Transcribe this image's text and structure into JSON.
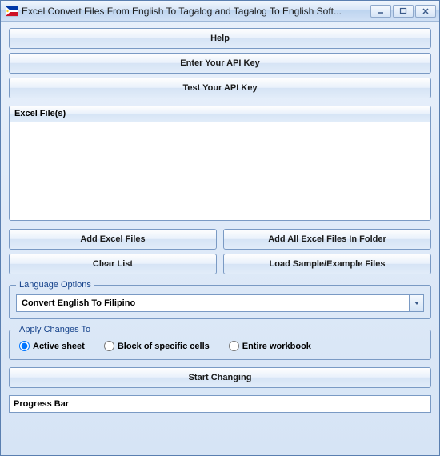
{
  "window": {
    "title": "Excel Convert Files From English To Tagalog and Tagalog To English Soft..."
  },
  "buttons": {
    "help": "Help",
    "enter_api": "Enter Your API Key",
    "test_api": "Test Your API Key",
    "add_files": "Add Excel Files",
    "add_folder": "Add All Excel Files In Folder",
    "clear_list": "Clear List",
    "load_sample": "Load Sample/Example Files",
    "start": "Start Changing"
  },
  "filebox": {
    "header": "Excel File(s)"
  },
  "language": {
    "legend": "Language Options",
    "selected": "Convert English To Filipino"
  },
  "apply": {
    "legend": "Apply Changes To",
    "options": {
      "active": "Active sheet",
      "block": "Block of specific cells",
      "entire": "Entire workbook"
    },
    "selected": "active"
  },
  "progress": {
    "label": "Progress Bar"
  }
}
